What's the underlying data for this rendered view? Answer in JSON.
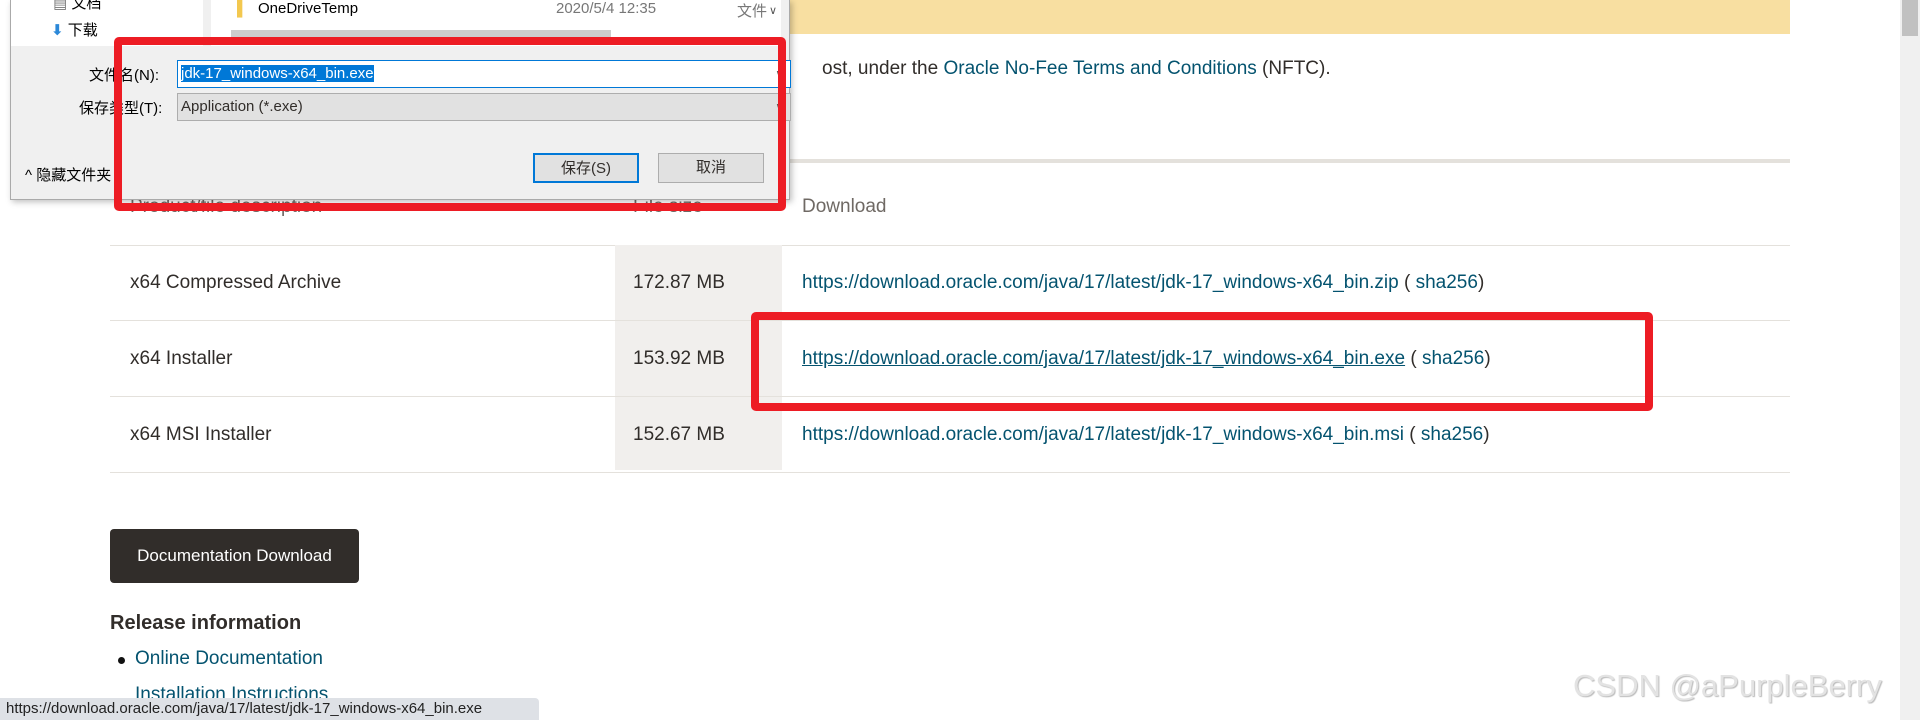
{
  "dialog": {
    "nav_items": [
      {
        "label": "文档",
        "icon": "document-icon"
      },
      {
        "label": "下载",
        "icon": "download-arrow-icon"
      }
    ],
    "file_row": {
      "name": "OneDriveTemp",
      "date": "2020/5/4 12:35",
      "type": "文件"
    },
    "filename_label": "文件名(N):",
    "filename_value": "jdk-17_windows-x64_bin.exe",
    "filetype_label": "保存类型(T):",
    "filetype_value": "Application (*.exe)",
    "hide_folders": "隐藏文件夹",
    "save_button": "保存(S)",
    "cancel_button": "取消"
  },
  "intro": {
    "prefix": "ost, under the ",
    "link": "Oracle No-Fee Terms and Conditions",
    "suffix": " (NFTC)."
  },
  "table": {
    "headers": [
      "Product/file description",
      "File size",
      "Download"
    ],
    "rows": [
      {
        "desc": "x64 Compressed Archive",
        "size": "172.87 MB",
        "url": "https://download.oracle.com/java/17/latest/jdk-17_windows-x64_bin.zip",
        "sha": "sha256"
      },
      {
        "desc": "x64 Installer",
        "size": "153.92 MB",
        "url": "https://download.oracle.com/java/17/latest/jdk-17_windows-x64_bin.exe",
        "sha": "sha256"
      },
      {
        "desc": "x64 MSI Installer",
        "size": "152.67 MB",
        "url": "https://download.oracle.com/java/17/latest/jdk-17_windows-x64_bin.msi",
        "sha": "sha256"
      }
    ]
  },
  "doc_button": "Documentation Download",
  "release": {
    "heading": "Release information",
    "items": [
      "Online Documentation",
      "Installation Instructions"
    ]
  },
  "status_url": "https://download.oracle.com/java/17/latest/jdk-17_windows-x64_bin.exe",
  "watermark": "CSDN @aPurpleBerry",
  "colors": {
    "link": "#04536f",
    "banner": "#f8dfa1",
    "annotation_red": "#ed1c24",
    "button_dark": "#312d2a"
  }
}
